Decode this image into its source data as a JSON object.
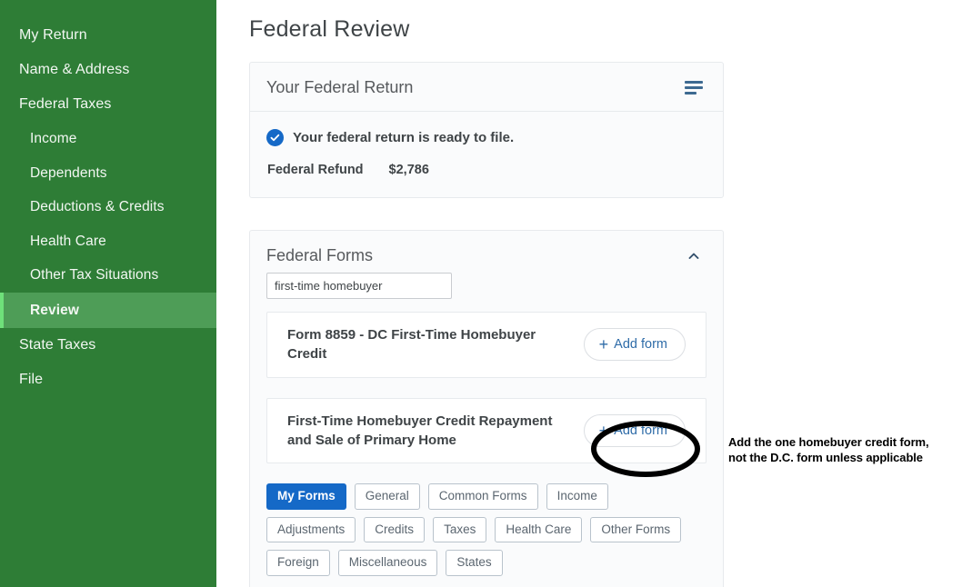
{
  "sidebar": {
    "items": [
      {
        "label": "My Return",
        "level": 0,
        "active": false
      },
      {
        "label": "Name & Address",
        "level": 0,
        "active": false
      },
      {
        "label": "Federal Taxes",
        "level": 0,
        "active": false
      },
      {
        "label": "Income",
        "level": 1,
        "active": false
      },
      {
        "label": "Dependents",
        "level": 1,
        "active": false
      },
      {
        "label": "Deductions & Credits",
        "level": 1,
        "active": false
      },
      {
        "label": "Health Care",
        "level": 1,
        "active": false
      },
      {
        "label": "Other Tax Situations",
        "level": 1,
        "active": false
      },
      {
        "label": "Review",
        "level": 1,
        "active": true
      },
      {
        "label": "State Taxes",
        "level": 0,
        "active": false
      },
      {
        "label": "File",
        "level": 0,
        "active": false
      }
    ],
    "bg_color": "#2e7d36",
    "active_bg_color": "#4e9d57",
    "active_accent_color": "#6fe07a"
  },
  "page": {
    "title": "Federal Review"
  },
  "return_card": {
    "title": "Your Federal Return",
    "menu_icon": "hamburger-icon",
    "status_icon": "check-circle-icon",
    "status_text": "Your federal return is ready to file.",
    "refund_label": "Federal Refund",
    "refund_value": "$2,786",
    "accent_color": "#1569c7"
  },
  "forms_card": {
    "title": "Federal Forms",
    "collapse_icon": "chevron-up-icon",
    "search": {
      "value": "first-time homebuyer",
      "placeholder": "Search forms"
    },
    "rows": [
      {
        "name": "Form 8859 - DC First-Time Homebuyer Credit",
        "action_label": "Add form",
        "action_icon": "plus-icon",
        "highlighted": false
      },
      {
        "name": "First-Time Homebuyer Credit Repayment and Sale of Primary Home",
        "action_label": "Add form",
        "action_icon": "plus-icon",
        "highlighted": true
      }
    ],
    "chips": [
      {
        "label": "My Forms",
        "active": true
      },
      {
        "label": "General",
        "active": false
      },
      {
        "label": "Common Forms",
        "active": false
      },
      {
        "label": "Income",
        "active": false
      },
      {
        "label": "Adjustments",
        "active": false
      },
      {
        "label": "Credits",
        "active": false
      },
      {
        "label": "Taxes",
        "active": false
      },
      {
        "label": "Health Care",
        "active": false
      },
      {
        "label": "Other Forms",
        "active": false
      },
      {
        "label": "Foreign",
        "active": false
      },
      {
        "label": "Miscellaneous",
        "active": false
      },
      {
        "label": "States",
        "active": false
      }
    ],
    "active_chip_color": "#1569c7"
  },
  "annotation": {
    "line1": "Add the one homebuyer credit form,",
    "line2": "not the D.C. form unless applicable",
    "shape": "hand-drawn-ellipse",
    "color": "#000000"
  }
}
